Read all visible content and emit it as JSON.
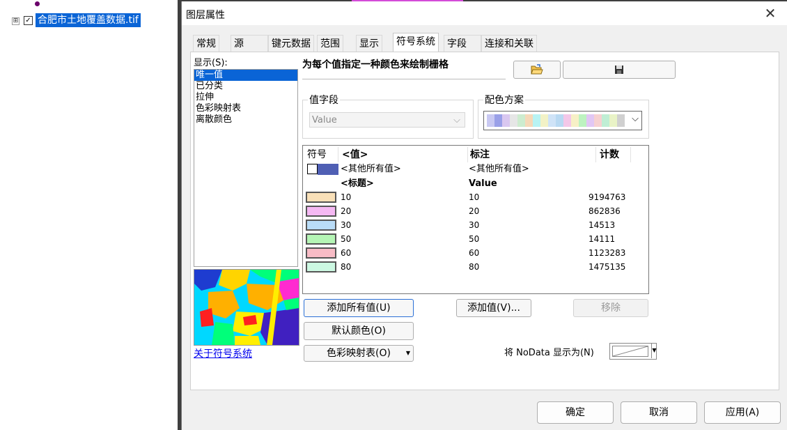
{
  "toc": {
    "layer_name": "合肥市土地覆盖数据.tif",
    "expand_symbol": "⊞",
    "check_symbol": "✓"
  },
  "dialog": {
    "title": "图层属性",
    "close_symbol": "✕",
    "tabs": [
      "常规",
      "源",
      "键元数据",
      "范围",
      "显示",
      "符号系统",
      "字段",
      "连接和关联"
    ],
    "active_tab": "符号系统",
    "show_label": "显示(S):",
    "show_options": [
      "唯一值",
      "已分类",
      "拉伸",
      "色彩映射表",
      "离散颜色"
    ],
    "selected_option": "唯一值",
    "heading": "为每个值指定一种颜色来绘制栅格",
    "about_link": "关于符号系统",
    "value_field_label": "值字段",
    "value_field_value": "Value",
    "color_scheme_label": "配色方案",
    "color_scheme_colors": [
      "#c9c9f2",
      "#9aa0e8",
      "#d9c7f0",
      "#e6e6e6",
      "#cdeccf",
      "#f5d9b9",
      "#b8f3f3",
      "#f2f2c6",
      "#cfe3f7",
      "#b9d9f2",
      "#f3c7e8",
      "#f7f0c6",
      "#bdf3c0",
      "#e1c7f4",
      "#f6d1d1",
      "#bfeed4",
      "#e9f3c6",
      "#d0d0d0"
    ],
    "table": {
      "headers": {
        "symbol": "符号",
        "value": "<值>",
        "label": "标注",
        "count": "计数"
      },
      "other_row": {
        "value": "<其他所有值>",
        "label": "<其他所有值>",
        "color": "#4f5fb4"
      },
      "heading_row": {
        "value": "<标题>",
        "label": "Value"
      },
      "rows": [
        {
          "value": "10",
          "label": "10",
          "count": "9194763",
          "color": "#f9e0b8"
        },
        {
          "value": "20",
          "label": "20",
          "count": "862836",
          "color": "#f5b8f3"
        },
        {
          "value": "30",
          "label": "30",
          "count": "14513",
          "color": "#b9dcf7"
        },
        {
          "value": "50",
          "label": "50",
          "count": "14111",
          "color": "#b5f5b5"
        },
        {
          "value": "60",
          "label": "60",
          "count": "1123283",
          "color": "#f8bcc6"
        },
        {
          "value": "80",
          "label": "80",
          "count": "1475135",
          "color": "#ccf8e2"
        }
      ]
    },
    "buttons": {
      "add_all": "添加所有值(U)",
      "add_values": "添加值(V)...",
      "remove": "移除",
      "default_colors": "默认颜色(O)",
      "colormap": "色彩映射表(O)"
    },
    "nodata_label": "将 NoData 显示为(N)",
    "footer": {
      "ok": "确定",
      "cancel": "取消",
      "apply": "应用(A)"
    }
  }
}
